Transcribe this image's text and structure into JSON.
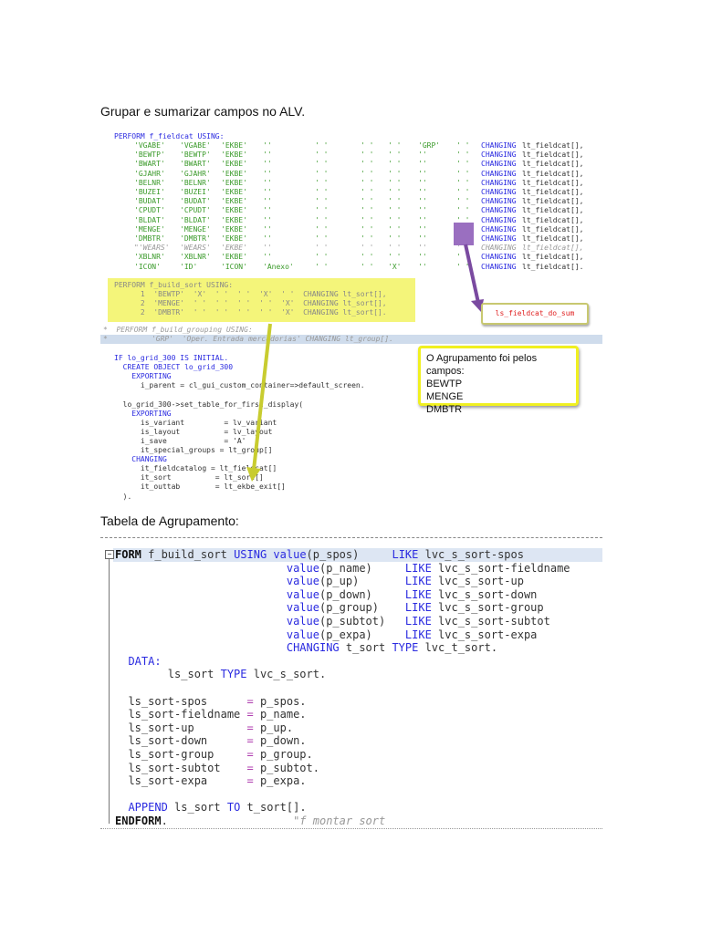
{
  "headings": {
    "section1": "Grupar e sumarizar campos no ALV.",
    "section2": "Tabela de Agrupamento:"
  },
  "fieldcat": {
    "header": "PERFORM f_fieldcat USING:",
    "changing": "CHANGING",
    "rows": [
      {
        "cells": [
          "'VGABE'",
          "'VGABE'",
          "'EKBE'",
          "''",
          "' '",
          "' '",
          "' '",
          "'GRP'",
          "' '"
        ],
        "target": "lt_fieldcat[],",
        "commented": false
      },
      {
        "cells": [
          "'BEWTP'",
          "'BEWTP'",
          "'EKBE'",
          "''",
          "' '",
          "' '",
          "' '",
          "''",
          "' '"
        ],
        "target": "lt_fieldcat[],",
        "commented": false
      },
      {
        "cells": [
          "'BWART'",
          "'BWART'",
          "'EKBE'",
          "''",
          "' '",
          "' '",
          "' '",
          "''",
          "' '"
        ],
        "target": "lt_fieldcat[],",
        "commented": false
      },
      {
        "cells": [
          "'GJAHR'",
          "'GJAHR'",
          "'EKBE'",
          "''",
          "' '",
          "' '",
          "' '",
          "''",
          "' '"
        ],
        "target": "lt_fieldcat[],",
        "commented": false
      },
      {
        "cells": [
          "'BELNR'",
          "'BELNR'",
          "'EKBE'",
          "''",
          "' '",
          "' '",
          "' '",
          "''",
          "' '"
        ],
        "target": "lt_fieldcat[],",
        "commented": false
      },
      {
        "cells": [
          "'BUZEI'",
          "'BUZEI'",
          "'EKBE'",
          "''",
          "' '",
          "' '",
          "' '",
          "''",
          "' '"
        ],
        "target": "lt_fieldcat[],",
        "commented": false
      },
      {
        "cells": [
          "'BUDAT'",
          "'BUDAT'",
          "'EKBE'",
          "''",
          "' '",
          "' '",
          "' '",
          "''",
          "' '"
        ],
        "target": "lt_fieldcat[],",
        "commented": false
      },
      {
        "cells": [
          "'CPUDT'",
          "'CPUDT'",
          "'EKBE'",
          "''",
          "' '",
          "' '",
          "' '",
          "''",
          "' '"
        ],
        "target": "lt_fieldcat[],",
        "commented": false
      },
      {
        "cells": [
          "'BLDAT'",
          "'BLDAT'",
          "'EKBE'",
          "''",
          "' '",
          "' '",
          "' '",
          "''",
          "' '"
        ],
        "target": "lt_fieldcat[],",
        "commented": false
      },
      {
        "cells": [
          "'MENGE'",
          "'MENGE'",
          "'EKBE'",
          "''",
          "' '",
          "' '",
          "' '",
          "''",
          "'X'"
        ],
        "target": "lt_fieldcat[],",
        "commented": false
      },
      {
        "cells": [
          "'DMBTR'",
          "'DMBTR'",
          "'EKBE'",
          "''",
          "' '",
          "' '",
          "' '",
          "''",
          "'X'"
        ],
        "target": "lt_fieldcat[],",
        "commented": false
      },
      {
        "cells": [
          "\"'WEARS'",
          "'WEARS'",
          "'EKBE'",
          "''",
          "' '",
          "' '",
          "' '",
          "''",
          "' '"
        ],
        "target": "lt_fieldcat[],",
        "commented": true
      },
      {
        "cells": [
          "'XBLNR'",
          "'XBLNR'",
          "'EKBE'",
          "''",
          "' '",
          "' '",
          "' '",
          "''",
          "' '"
        ],
        "target": "lt_fieldcat[],",
        "commented": false
      },
      {
        "cells": [
          "'ICON'",
          "'ID'",
          "'ICON'",
          "'Anexo'",
          "' '",
          "' '",
          "'X'",
          "''",
          "' '"
        ],
        "target": "lt_fieldcat[].",
        "commented": false
      }
    ]
  },
  "build_sort_call": [
    "PERFORM f_build_sort USING:",
    "      1  'BEWTP'  'X'  ' '  ' '  'X'  ' '  CHANGING lt_sort[],",
    "      2  'MENGE'  ' '  ' '  ' '  ' '  'X'  CHANGING lt_sort[],",
    "      2  'DMBTR'  ' '  ' '  ' '  ' '  'X'  CHANGING lt_sort[]."
  ],
  "grouping_comment": [
    "*  PERFORM f_build_grouping USING:",
    "*          'GRP'  'Oper. Entrada mercadorias' CHANGING lt_group[]."
  ],
  "grid_code": [
    "IF lo_grid_300 IS INITIAL.",
    "  CREATE OBJECT lo_grid_300",
    "    EXPORTING",
    "      i_parent = cl_gui_custom_container=>default_screen.",
    "",
    "  lo_grid_300->set_table_for_first_display(",
    "    EXPORTING",
    "      is_variant         = lv_variant",
    "      is_layout          = lv_layout",
    "      i_save             = 'A'",
    "      it_special_groups = lt_group[]",
    "    CHANGING",
    "      it_fieldcatalog = lt_fieldcat[]",
    "      it_sort          = lt_sort[]",
    "      it_outtab        = lt_ekbe_exit[]",
    "  )."
  ],
  "annotations": {
    "sum_label": "ls_fieldcat_do_sum",
    "callout_title": "O Agrupamento foi pelos campos:",
    "callout_fields": [
      "BEWTP",
      "MENGE",
      "DMBTR"
    ],
    "arrow_colors": {
      "purple": "#7a4aa0",
      "yellow": "#c8cc30"
    }
  },
  "form_code": [
    [
      [
        "FORM",
        "bold"
      ],
      [
        " f_build_sort ",
        "id"
      ],
      [
        "USING",
        "kwb"
      ],
      [
        " ",
        "id"
      ],
      [
        "value",
        "kwb"
      ],
      [
        "(p_spos)     ",
        "id"
      ],
      [
        "LIKE",
        "kwb"
      ],
      [
        " lvc_s_sort-spos",
        "id"
      ]
    ],
    [
      [
        "                          ",
        "id"
      ],
      [
        "value",
        "kwb"
      ],
      [
        "(p_name)     ",
        "id"
      ],
      [
        "LIKE",
        "kwb"
      ],
      [
        " lvc_s_sort-fieldname",
        "id"
      ]
    ],
    [
      [
        "                          ",
        "id"
      ],
      [
        "value",
        "kwb"
      ],
      [
        "(p_up)       ",
        "id"
      ],
      [
        "LIKE",
        "kwb"
      ],
      [
        " lvc_s_sort-up",
        "id"
      ]
    ],
    [
      [
        "                          ",
        "id"
      ],
      [
        "value",
        "kwb"
      ],
      [
        "(p_down)     ",
        "id"
      ],
      [
        "LIKE",
        "kwb"
      ],
      [
        " lvc_s_sort-down",
        "id"
      ]
    ],
    [
      [
        "                          ",
        "id"
      ],
      [
        "value",
        "kwb"
      ],
      [
        "(p_group)    ",
        "id"
      ],
      [
        "LIKE",
        "kwb"
      ],
      [
        " lvc_s_sort-group",
        "id"
      ]
    ],
    [
      [
        "                          ",
        "id"
      ],
      [
        "value",
        "kwb"
      ],
      [
        "(p_subtot)   ",
        "id"
      ],
      [
        "LIKE",
        "kwb"
      ],
      [
        " lvc_s_sort-subtot",
        "id"
      ]
    ],
    [
      [
        "                          ",
        "id"
      ],
      [
        "value",
        "kwb"
      ],
      [
        "(p_expa)     ",
        "id"
      ],
      [
        "LIKE",
        "kwb"
      ],
      [
        " lvc_s_sort-expa",
        "id"
      ]
    ],
    [
      [
        "                          ",
        "id"
      ],
      [
        "CHANGING",
        "kwb"
      ],
      [
        " t_sort ",
        "id"
      ],
      [
        "TYPE",
        "kwb"
      ],
      [
        " lvc_t_sort.",
        "id"
      ]
    ],
    [
      [
        "  ",
        "id"
      ],
      [
        "DATA:",
        "kwb"
      ]
    ],
    [
      [
        "        ls_sort ",
        "id"
      ],
      [
        "TYPE",
        "kwb"
      ],
      [
        " lvc_s_sort.",
        "id"
      ]
    ],
    [
      [
        "",
        "id"
      ]
    ],
    [
      [
        "  ls_sort-spos      ",
        "id"
      ],
      [
        "=",
        "op"
      ],
      [
        " p_spos.",
        "id"
      ]
    ],
    [
      [
        "  ls_sort-fieldname ",
        "id"
      ],
      [
        "=",
        "op"
      ],
      [
        " p_name.",
        "id"
      ]
    ],
    [
      [
        "  ls_sort-up        ",
        "id"
      ],
      [
        "=",
        "op"
      ],
      [
        " p_up.",
        "id"
      ]
    ],
    [
      [
        "  ls_sort-down      ",
        "id"
      ],
      [
        "=",
        "op"
      ],
      [
        " p_down.",
        "id"
      ]
    ],
    [
      [
        "  ls_sort-group     ",
        "id"
      ],
      [
        "=",
        "op"
      ],
      [
        " p_group.",
        "id"
      ]
    ],
    [
      [
        "  ls_sort-subtot    ",
        "id"
      ],
      [
        "=",
        "op"
      ],
      [
        " p_subtot.",
        "id"
      ]
    ],
    [
      [
        "  ls_sort-expa      ",
        "id"
      ],
      [
        "=",
        "op"
      ],
      [
        " p_expa.",
        "id"
      ]
    ],
    [
      [
        "",
        "id"
      ]
    ],
    [
      [
        "  ",
        "id"
      ],
      [
        "APPEND",
        "kwb"
      ],
      [
        " ls_sort ",
        "id"
      ],
      [
        "TO",
        "kwb"
      ],
      [
        " t_sort[].",
        "id"
      ]
    ],
    [
      [
        "ENDFORM",
        "bold"
      ],
      [
        ".                   ",
        "id"
      ],
      [
        "\"f montar sort",
        "cm"
      ]
    ]
  ]
}
